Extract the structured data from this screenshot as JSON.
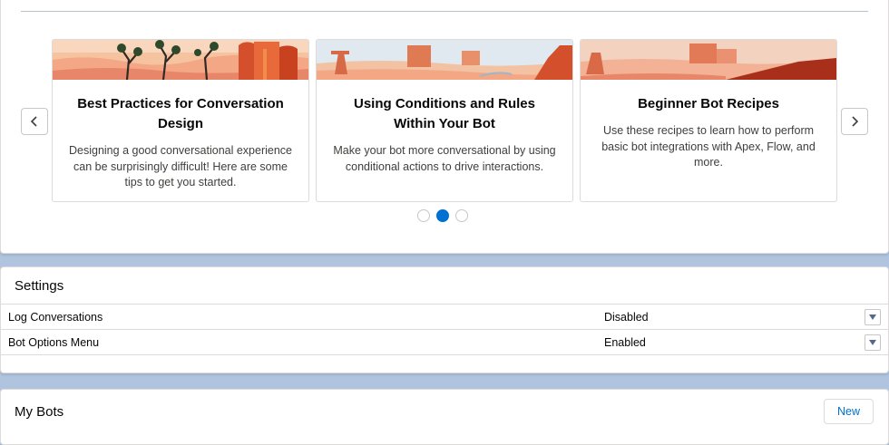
{
  "carousel": {
    "cards": [
      {
        "title": "Best Practices for Conversation Design",
        "description": "Designing a good conversational experience can be surprisingly difficult! Here are some tips to get you started."
      },
      {
        "title": "Using Conditions and Rules Within Your Bot",
        "description": "Make your bot more conversational by using conditional actions to drive interactions."
      },
      {
        "title": "Beginner Bot Recipes",
        "description": "Use these recipes to learn how to perform basic bot integrations with Apex, Flow, and more."
      }
    ],
    "active_page": 2,
    "page_count": 3,
    "prev_icon": "chevron-left-icon",
    "next_icon": "chevron-right-icon"
  },
  "settings": {
    "title": "Settings",
    "rows": [
      {
        "label": "Log Conversations",
        "value": "Disabled"
      },
      {
        "label": "Bot Options Menu",
        "value": "Enabled"
      }
    ]
  },
  "my_bots": {
    "title": "My Bots",
    "new_label": "New"
  },
  "colors": {
    "page_background": "#b0c4df",
    "accent": "#0070d2",
    "desert_sand": "#f4a583",
    "desert_rock": "#d3502a"
  }
}
